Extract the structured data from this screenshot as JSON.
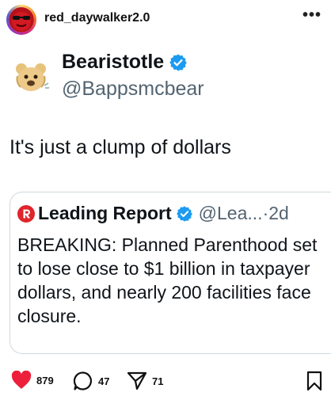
{
  "post": {
    "username": "red_daywalker2.0",
    "more_label": "•••"
  },
  "tweet": {
    "display_name": "Bearistotle",
    "handle": "@Bappsmcbear",
    "text": "It's just a clump of dollars"
  },
  "quote": {
    "display_name": "Leading Report",
    "handle": "@Lea...·2d",
    "body": "BREAKING: Planned Parenthood set to lose close to $1 billion in taxpayer dollars, and nearly 200 facilities face closure."
  },
  "actions": {
    "likes": "879",
    "comments": "47",
    "shares": "71"
  },
  "colors": {
    "verified": "#1d9bf0",
    "like": "#ed1f3a",
    "leading_report": "#e0242b"
  }
}
